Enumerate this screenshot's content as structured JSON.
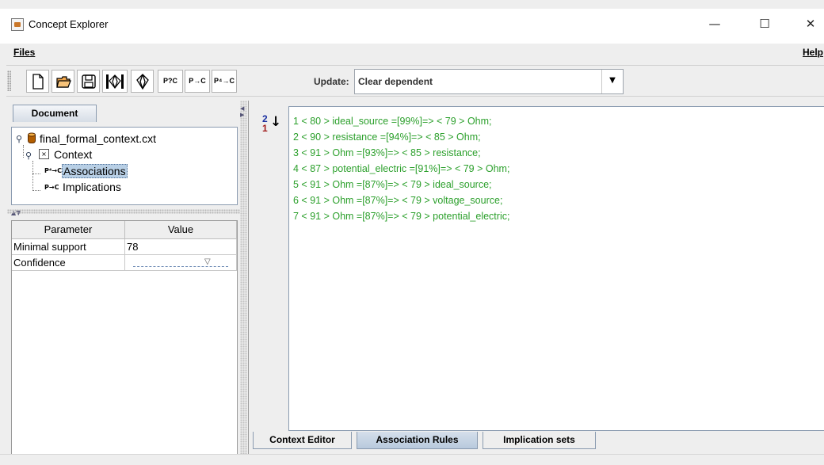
{
  "window": {
    "title": "Concept Explorer",
    "minimize_glyph": "—",
    "maximize_glyph": "☐",
    "close_glyph": "✕"
  },
  "menu": {
    "files": "Files",
    "help": "Help"
  },
  "toolbar": {
    "buttons": [
      {
        "icon": "new-document-icon"
      },
      {
        "icon": "open-folder-icon"
      },
      {
        "icon": "save-icon"
      },
      {
        "icon": "lattice-view-icon"
      },
      {
        "icon": "concept-lattice-icon"
      },
      {
        "icon": "attribute-exploration-icon",
        "label": "P?C"
      },
      {
        "icon": "implications-icon",
        "label": "P→C"
      },
      {
        "icon": "association-rules-icon",
        "label": "P⁴→C"
      }
    ],
    "update_label": "Update:",
    "update_value": "Clear dependent"
  },
  "document_panel": {
    "tab": "Document",
    "tree": {
      "file": "final_formal_context.cxt",
      "context": "Context",
      "associations": "Associations",
      "implications": "Implications",
      "selected": "Associations"
    }
  },
  "parameters": {
    "headers": [
      "Parameter",
      "Value"
    ],
    "rows": [
      {
        "name": "Minimal support",
        "value": "78"
      },
      {
        "name": "Confidence",
        "value": ""
      }
    ]
  },
  "rules": [
    "1 < 80 > ideal_source =[99%]=> < 79 > Ohm;",
    "2 < 90 > resistance =[94%]=> < 85 > Ohm;",
    "3 < 91 > Ohm =[93%]=> < 85 > resistance;",
    "4 < 87 > potential_electric =[91%]=> < 79 > Ohm;",
    "5 < 91 > Ohm =[87%]=> < 79 > ideal_source;",
    "6 < 91 > Ohm =[87%]=> < 79 > voltage_source;",
    "7 < 91 > Ohm =[87%]=> < 79 > potential_electric;"
  ],
  "sort_button": {
    "top_digit": "2",
    "bottom_digit": "1",
    "arrow": "↓"
  },
  "bottom_tabs": [
    {
      "label": "Context Editor",
      "selected": false
    },
    {
      "label": "Association Rules",
      "selected": true
    },
    {
      "label": "Implication sets",
      "selected": false
    }
  ],
  "colors": {
    "rule_text": "#2ca02c",
    "selected_tree_bg": "#b8cfe5",
    "tab_selected": "#b8c9dd"
  }
}
